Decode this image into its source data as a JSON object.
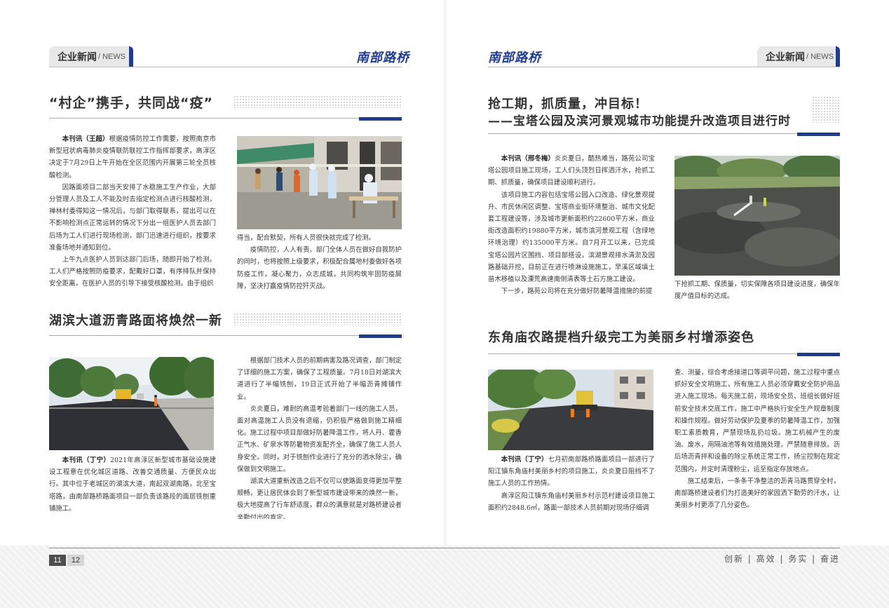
{
  "left_page": {
    "section_zh": "企业新闻",
    "section_en": "/ NEWS",
    "brand": "南部路桥",
    "page_number": "11"
  },
  "right_page": {
    "section_zh": "企业新闻",
    "section_en": "/ NEWS",
    "brand": "南部路桥",
    "page_number": "12"
  },
  "footer": {
    "slogan": "创新 | 高效 | 务实 | 奋进"
  },
  "article1": {
    "title": "“村企”携手，共同战“疫”",
    "col1": [
      "本刊讯（王超）根据疫情防控工作需要，按照南京市新型冠状病毒肺炎疫情联防联控工作指挥部要求，高淳区决定于7月29日上午开始在全区范围内开展第三轮全员核酸检测。",
      "因路面项目二部当天安排了水稳施工生产作业，大部分管理人员及工人不能及时去指定检测点进行核酸检测，禅林村委得知这一情况后，与部门取得联系，提出可以在不影响检测点正常运转的情况下分出一组医护人员去部门后场为工人们进行现场检测，部门迅速进行组织，按要求准备场地并通知到位。",
      "上午九点医护人员到达部门后场，随即开始了检测。工人们严格按照防疫要求，配戴好口罩，有序排队并保持安全距离，在医护人员的引导下接受核酸检测。由于组织"
    ],
    "col2": [
      "得当，配合默契，所有人员很快就完成了检测。",
      "疫情防控，人人有责。部门全体人员在做好自我防护的同时，也将按照上级要求，积极配合属地村委做好各项防疫工作，凝心聚力，众志成城，共同构筑牢固防疫屏障，坚决打赢疫情防控歼灭战。"
    ]
  },
  "article2": {
    "title": "湖滨大道沥青路面将焕然一新",
    "col1": [
      "本刊讯（丁宁）2021年高淳区新型城市基础设施建设工程意在优化城区道路、改善交通质量、方便民众出行。其中位于老城区的湖滨大道，南起双湖南路，北至宝塔路，由南部路桥路面项目一部负责该路段的面层铣刨重铺施工。"
    ],
    "col2": [
      "根据部门技术人员的前期病害及路况调查，部门制定了详细的施工方案，确保了工程质量。7月18日对湖滨大道进行了半幅铣刨，19日正式开始了半幅沥青摊铺作业。",
      "炎炎夏日，难耐的高温考验着部门一线的施工人员，面对高温施工人员没有退缩，仍积极严格做到施工精细化。施工过程中项目部做好防暑降温工作，将人丹、藿香正气水、矿泉水等防暑物资发配齐全，确保了施工人员人身安全。同时，对于铣刨作业进行了充分的洒水除尘，确保做到文明施工。",
      "湖滨大道重新改造之后不仅可以使路面变得更加平整顺畅，更让居民体会到了新型城市建设带来的焕然一新，极大地提高了行车舒适度，群众的满意就是对路桥建设者辛勤付出的肯定。"
    ]
  },
  "article3": {
    "title_line1": "抢工期，抓质量，冲目标！",
    "title_line2": "——宝塔公园及滨河景观城市功能提升改造项目进行时",
    "col1": [
      "本刊讯（邢冬梅）炎炎夏日，酷热难当，路苑公司宝塔公园项目施工现场，工人们头顶烈日挥洒汗水，抢抓工期、抓质量，确保项目建设顺利进行。",
      "该项目施工内容包括宝塔公园入口改造、绿化景观提升、市民休闲区调整、宝塔商业街环境整治、城市文化配套工程建设等，涉及城市更新面积约22600平方米，商业街改造面积约19880平方米，城市滨河景观工程（含绿地环境治理）约135000平方米。自7月开工以来，已完成宝塔公园片区围挡、项目部搭设，滨湖景观排水清淤及园路基础开挖，目前正在进行喷淋设施施工，早溪区域填土苗木移植以及溧荒高速南侧清表等土石方施工建设。",
      "下一步，路苑公司将在充分做好防暑降温措施的前提"
    ],
    "col2": [
      "下抢抓工期、保质量，切实保障各项目建设进度，确保年度产值目标的达成。"
    ]
  },
  "article4": {
    "title": "东角庙农路提档升级完工为美丽乡村增添姿色",
    "col1": [
      "本刊讯（丁宁）七月初南部路桥路面项目一部进行了阳江镇东角庙村美丽乡村的项目施工，炎炎夏日阻挡不了施工人员的工作热情。",
      "高淳区阳江镇东角庙村美丽乡村示范村建设项目施工面积约2848.6㎡，路面一部技术人员前期对现场仔细调"
    ],
    "col2": [
      "查、测量，综合考虑接道口等调平问题，施工过程中重点抓好安全文明施工，所有施工人员必须穿戴安全防护用品进入施工现场。每天施工前，现场安全员、班组长做好班前安全技术交底工作，施工中严格执行安全生产规章制度和操作规程。做好劳动保护及夏季的防暑降温工作，加强职工素质教育，严禁现场乱扔垃圾。施工机械产生的废油、废水，用隔油池等有效措施处理，严禁随意排放。沥后场沥青拌和设备的除尘系统正常工作，扬尘控制在规定范围内，并定时清理粉尘，运至指定存放地点。",
      "施工结束后，一条条干净整洁的沥青马路贯穿全村，南部路桥建设者们为打造美好的家园洒下勤劳的汗水，让美丽乡村更添了几分姿色。"
    ]
  }
}
